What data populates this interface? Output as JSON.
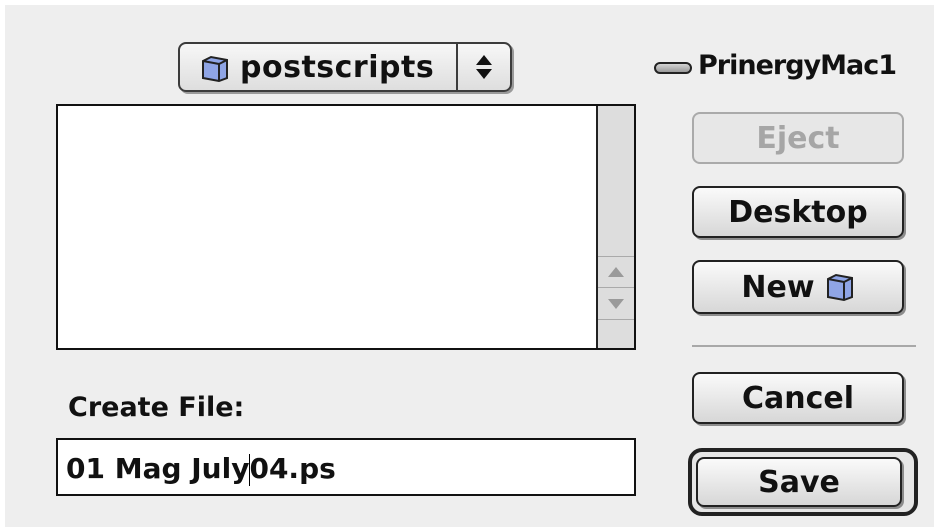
{
  "folder_popup": {
    "label": "postscripts",
    "icon": "folder-icon"
  },
  "volume": {
    "name": "PrinergyMac1",
    "icon": "disk-icon"
  },
  "buttons": {
    "eject": "Eject",
    "desktop": "Desktop",
    "new": "New",
    "cancel": "Cancel",
    "save": "Save"
  },
  "file_list": {
    "items": []
  },
  "create_file": {
    "label": "Create File:",
    "value_before_caret": "01 Mag July",
    "value_after_caret": "04.ps"
  }
}
